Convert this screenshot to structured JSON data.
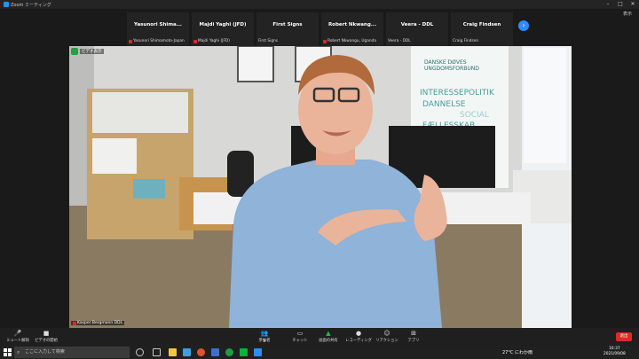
{
  "window": {
    "title": "Zoom ミーティング",
    "restore_label": "表示"
  },
  "gallery": [
    {
      "name": "Yasunori  Shima...",
      "label": "Yasunori Shimamoto-Japan"
    },
    {
      "name": "Majdi Yaghi (JFD)",
      "label": "Majdi Yaghi (JFD)"
    },
    {
      "name": "First Signs",
      "label": "First Signs"
    },
    {
      "name": "Robert  Nkwang...",
      "label": "Robert Nkwangu, Uganda"
    },
    {
      "name": "Veera - DDL",
      "label": "Veera - DDL"
    },
    {
      "name": "Craig Findsen",
      "label": "Craig Findsen"
    }
  ],
  "video": {
    "camera_label": "ビデオ表示",
    "speaker": "Kasper Bergmann DDL",
    "poster_text_1": "DANSKE DØVES",
    "poster_text_2": "UNGDOMSFORBUND",
    "poster_text_3": "INTERESSEPOLITIK",
    "poster_text_4": "DANNELSE",
    "poster_text_5": "SOCIAL",
    "poster_text_6": "FÆLLESSKAB"
  },
  "toolbar": {
    "mute": "ミュート解除",
    "video": "ビデオの開始",
    "participants": "参加者",
    "participants_count": "9",
    "chat": "チャット",
    "share": "画面の共有",
    "record": "レコーディング",
    "reactions": "リアクション",
    "apps": "アプリ",
    "end": "退出"
  },
  "taskbar": {
    "search_placeholder": "ここに入力して検索",
    "weather": "27°C  にわか雨",
    "time": "16:37",
    "date": "2021/09/08"
  },
  "colors": {
    "accent": "#2d8cff",
    "end": "#e02828",
    "secure": "#22a045"
  }
}
